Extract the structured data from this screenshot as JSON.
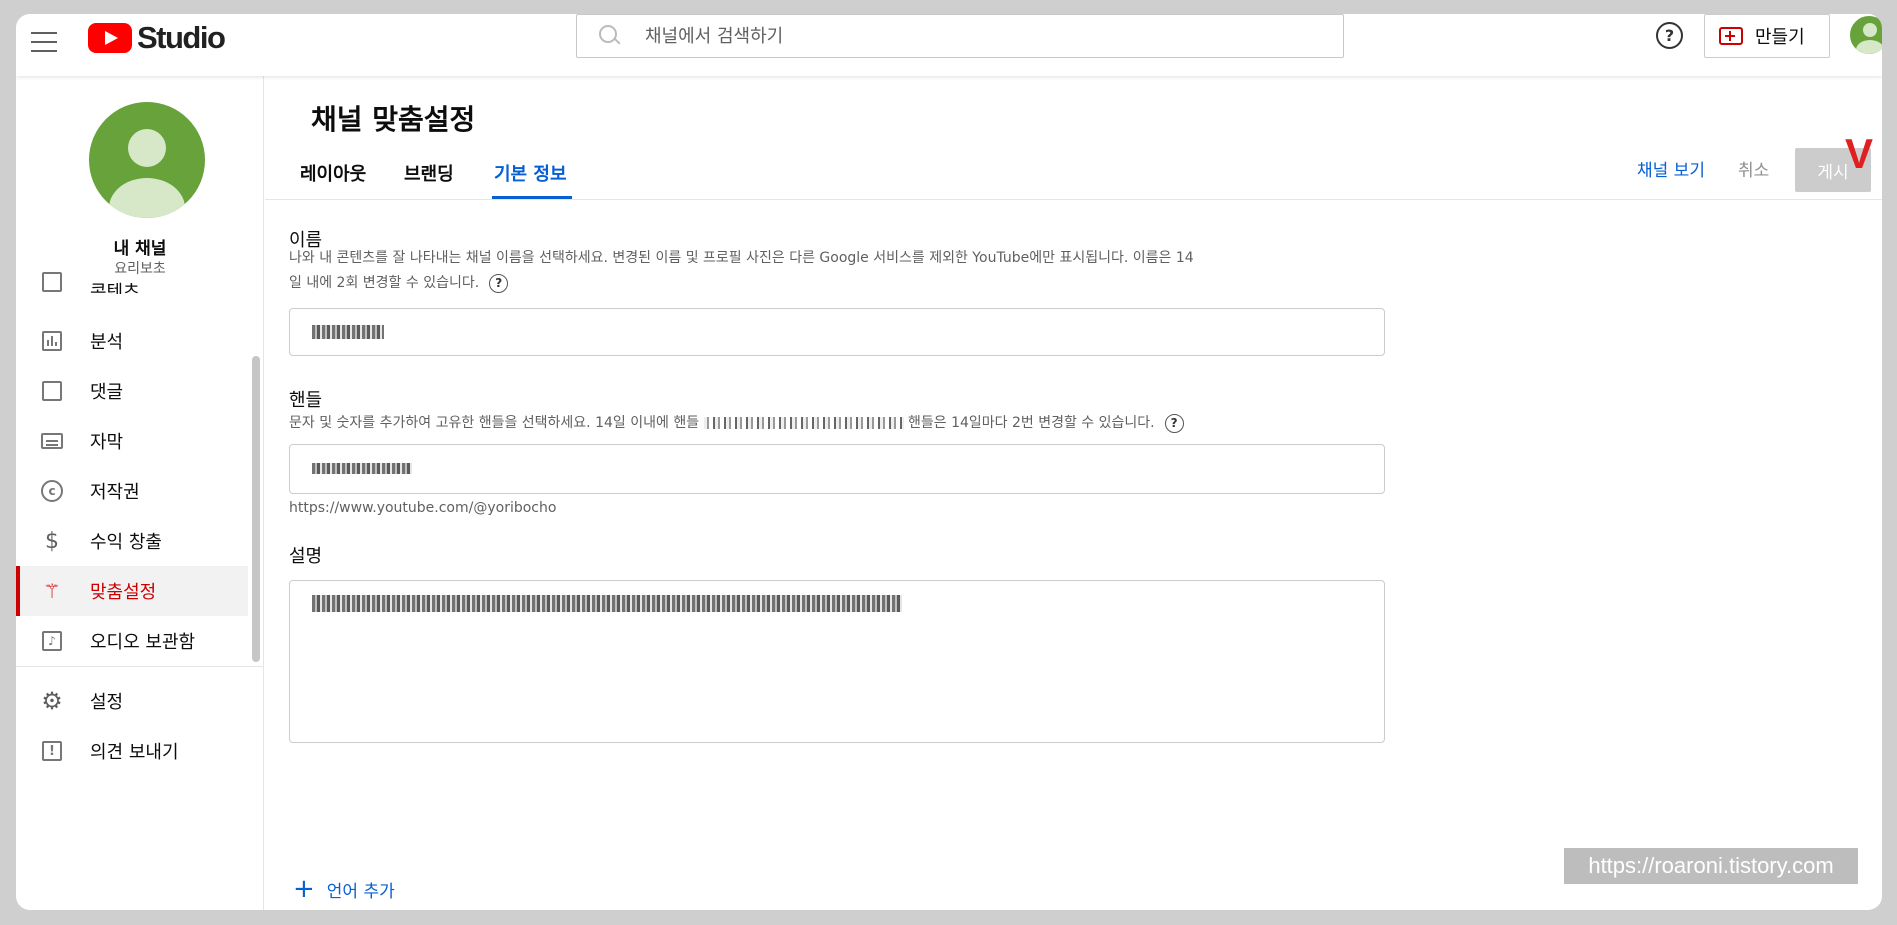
{
  "topbar": {
    "logo_text": "Studio",
    "search_placeholder": "채널에서 검색하기",
    "help_glyph": "?",
    "create_label": "만들기"
  },
  "sidebar": {
    "channel_name": "내 채널",
    "channel_handle": "요리보초",
    "items": [
      {
        "label": "콘텐츠",
        "icon": "content-icon"
      },
      {
        "label": "분석",
        "icon": "analytics-icon"
      },
      {
        "label": "댓글",
        "icon": "comments-icon"
      },
      {
        "label": "자막",
        "icon": "subtitles-icon"
      },
      {
        "label": "저작권",
        "icon": "copyright-icon"
      },
      {
        "label": "수익 창출",
        "icon": "dollar-icon"
      },
      {
        "label": "맞춤설정",
        "icon": "magic-wand-icon",
        "active": true
      },
      {
        "label": "오디오 보관함",
        "icon": "audio-library-icon"
      },
      {
        "label": "설정",
        "icon": "gear-icon"
      },
      {
        "label": "의견 보내기",
        "icon": "feedback-icon"
      }
    ]
  },
  "main": {
    "title": "채널 맞춤설정",
    "tabs": [
      {
        "label": "레이아웃"
      },
      {
        "label": "브랜딩"
      },
      {
        "label": "기본 정보",
        "active": true
      }
    ],
    "view_channel": "채널 보기",
    "cancel": "취소",
    "publish": "게시",
    "annotation_mark": "V",
    "name_label": "이름",
    "name_desc_line1": "나와 내 콘텐츠를 잘 나타내는 채널 이름을 선택하세요. 변경된 이름 및 프로필 사진은 다른 Google 서비스를 제외한 YouTube에만 표시됩니다. 이름은 14",
    "name_desc_line2": "일 내에 2회 변경할 수 있습니다.",
    "handle_label": "핸들",
    "handle_desc_before": "문자 및 숫자를 추가하여 고유한 핸들을 선택하세요. 14일 이내에 핸들",
    "handle_desc_after": "핸들은 14일마다 2번 변경할 수 있습니다.",
    "handle_url": "https://www.youtube.com/@yoribocho",
    "description_label": "설명",
    "add_language": "언어 추가"
  },
  "watermark": "https://roaroni.tistory.com",
  "colors": {
    "accent_blue": "#065fd4",
    "active_red": "#cc0000",
    "avatar_green": "#67a23b"
  }
}
